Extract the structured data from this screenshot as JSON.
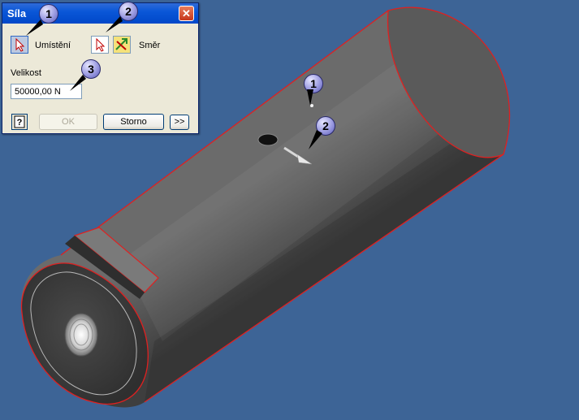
{
  "dialog": {
    "title": "Síla",
    "placement_label": "Umístění",
    "direction_label": "Směr",
    "size_label": "Velikost",
    "size_value": "50000,00 N",
    "ok_label": "OK",
    "cancel_label": "Storno",
    "more_label": ">>",
    "help_icon": "help-icon",
    "close_icon": "close-icon"
  },
  "callouts": {
    "placement": "1",
    "direction": "2",
    "size": "3",
    "model_point": "1",
    "model_arrow": "2"
  },
  "colors": {
    "background": "#3d6496",
    "edge_highlight": "#e02020",
    "titlebar": "#0a57d8"
  }
}
